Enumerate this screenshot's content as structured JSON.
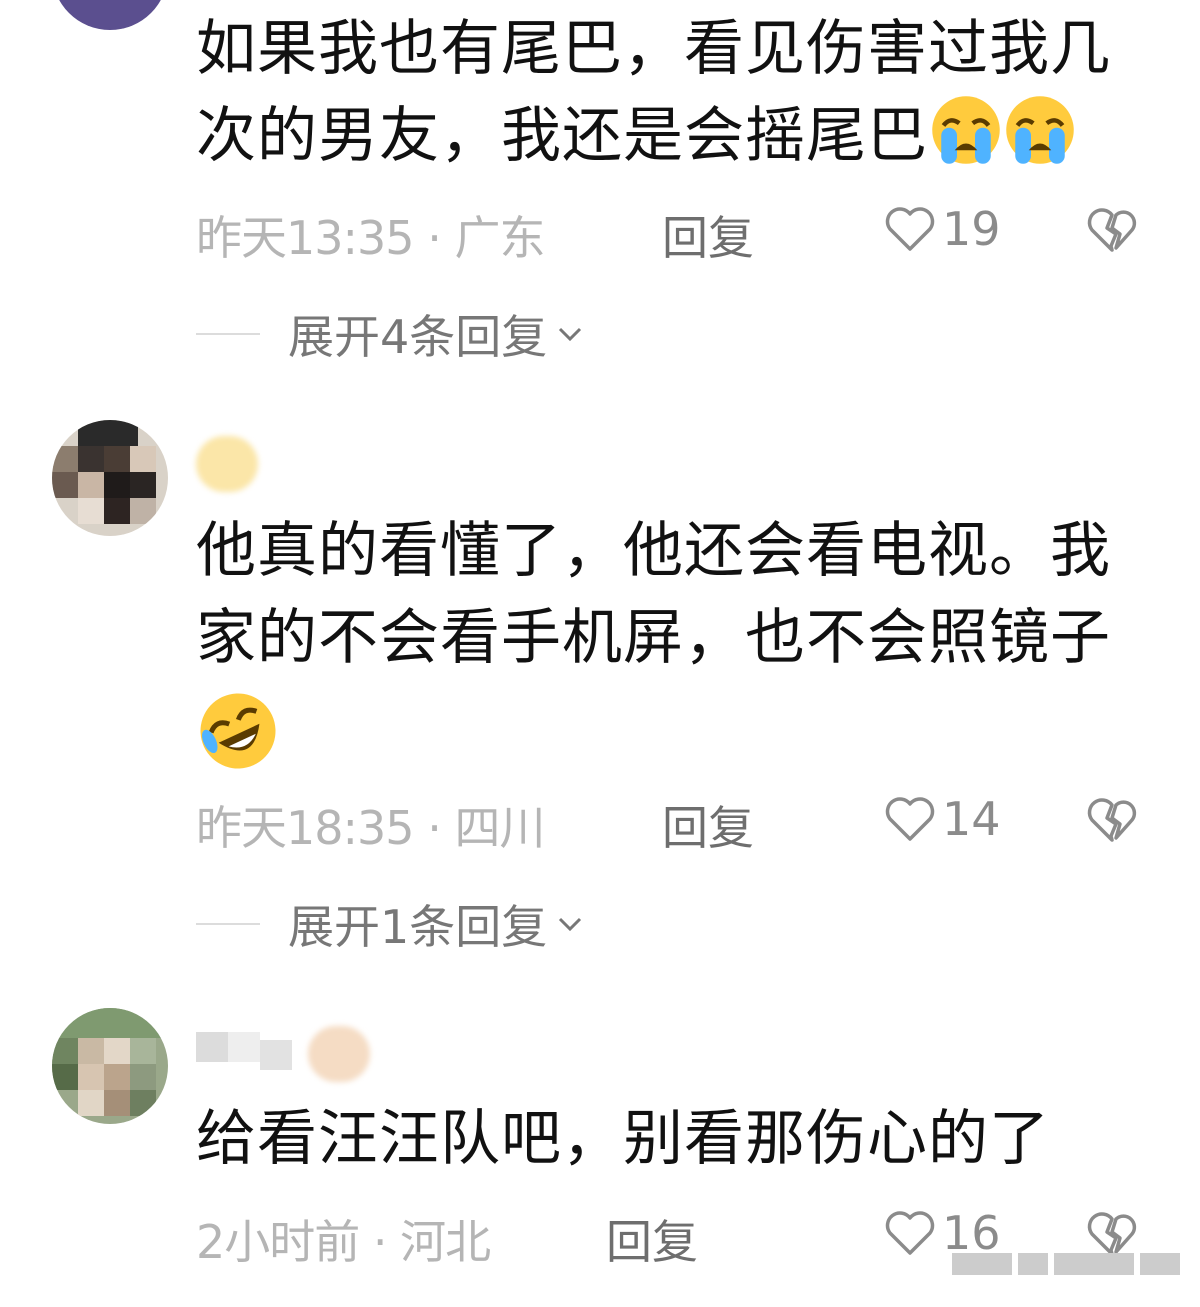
{
  "comments": [
    {
      "text": "如果我也有尾巴，看见伤害过我几次的男友，我还是会摇尾巴",
      "emojis": [
        "loudly-crying-face",
        "loudly-crying-face"
      ],
      "time": "昨天13:35",
      "dot": "·",
      "location": "广东",
      "reply_label": "回复",
      "likes": "19",
      "expand_label": "展开4条回复"
    },
    {
      "text": "他真的看懂了，他还会看电视。我家的不会看手机屏，也不会照镜子",
      "emojis": [
        "rolling-on-floor-laughing"
      ],
      "time": "昨天18:35",
      "dot": "·",
      "location": "四川",
      "reply_label": "回复",
      "likes": "14",
      "expand_label": "展开1条回复"
    },
    {
      "text": "给看汪汪队吧，别看那伤心的了",
      "emojis": [],
      "time": "2小时前",
      "dot": "·",
      "location": "河北",
      "reply_label": "回复",
      "likes": "16"
    }
  ],
  "colors": {
    "text": "#111111",
    "meta": "#b5b5b5",
    "reply": "#6e6e6e",
    "like": "#8b8b8b",
    "expand": "#777777",
    "divider": "#dcdcdc"
  },
  "icons": {
    "like": "heart-outline-icon",
    "dislike": "broken-heart-icon",
    "expand": "chevron-down-icon"
  }
}
